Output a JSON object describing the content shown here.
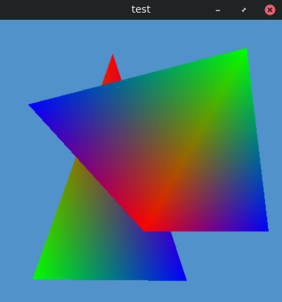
{
  "window": {
    "title": "test",
    "background_color": "#5092c9",
    "titlebar_color": "#202324",
    "controls": {
      "minimize_icon": "minimize-icon",
      "maximize_icon": "maximize-icon",
      "close_icon": "close-icon",
      "close_color": "#e95d6f"
    }
  },
  "scene": {
    "back_triangle": {
      "vertex_colors": [
        "#ff0000",
        "#00ff00",
        "#0000ff"
      ]
    },
    "front_triangle": {
      "vertex_colors": [
        "#00ff00",
        "#ff0000",
        "#0000ff"
      ]
    }
  }
}
